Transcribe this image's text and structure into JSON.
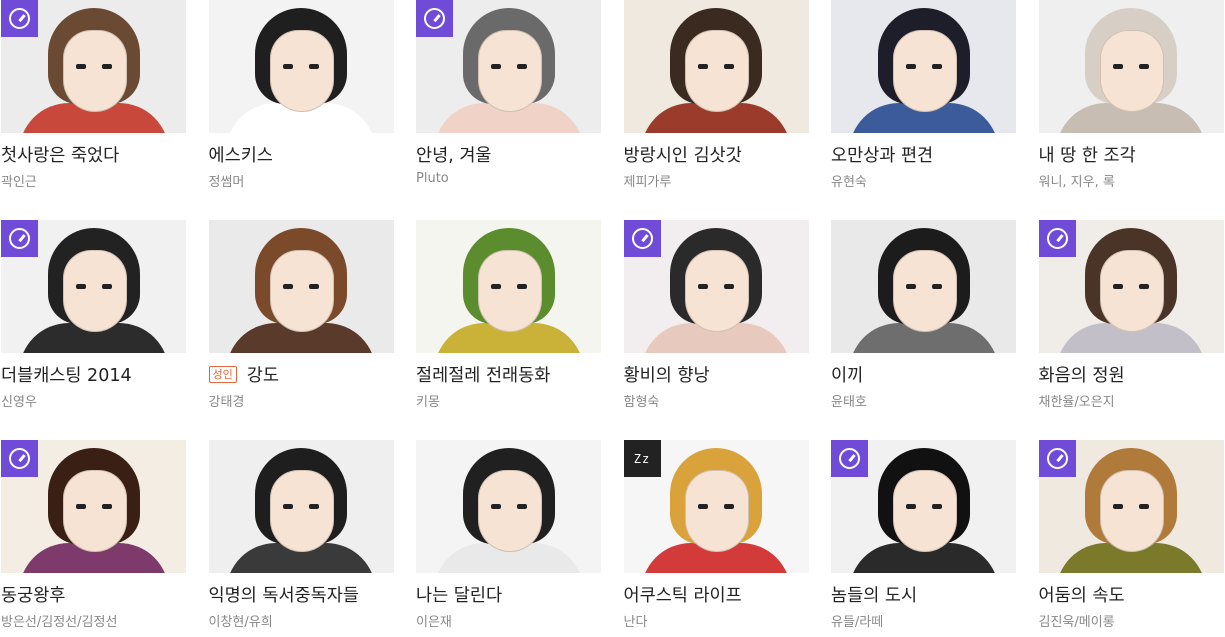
{
  "adult_label": "성인",
  "badge_text": "Zz",
  "items": [
    {
      "title": "첫사랑은 죽었다",
      "author": "곽인근",
      "badge": "clock-icon",
      "bg": "#ececec",
      "hair": "#6b4a34",
      "body": "#c9483c"
    },
    {
      "title": "에스키스",
      "author": "정썸머",
      "badge": "none",
      "bg": "#f3f3f3",
      "hair": "#1f1f1f",
      "body": "#ffffff"
    },
    {
      "title": "안녕, 겨울",
      "author": "Pluto",
      "badge": "clock-icon",
      "bg": "#ededed",
      "hair": "#6a6a6a",
      "body": "#f0d2c6"
    },
    {
      "title": "방랑시인 김삿갓",
      "author": "제피가루",
      "badge": "none",
      "bg": "#efe9df",
      "hair": "#3a2a20",
      "body": "#9a3b2b"
    },
    {
      "title": "오만상과 편견",
      "author": "유현숙",
      "badge": "none",
      "bg": "#e7e8ee",
      "hair": "#1e1e2a",
      "body": "#3c5b9a"
    },
    {
      "title": "내 땅 한 조각",
      "author": "워니, 지우, 록",
      "badge": "none",
      "bg": "#efefef",
      "hair": "#d7cfc6",
      "body": "#c7bdb2"
    },
    {
      "title": "더블캐스팅 2014",
      "author": "신영우",
      "badge": "clock-icon",
      "bg": "#f1f1f1",
      "hair": "#222222",
      "body": "#2c2c2c"
    },
    {
      "title": "강도",
      "author": "강태경",
      "badge": "none",
      "adult": true,
      "bg": "#eaeaea",
      "hair": "#7a4a2a",
      "body": "#5a3a2a"
    },
    {
      "title": "절레절레 전래동화",
      "author": "키몽",
      "badge": "none",
      "bg": "#f5f5f0",
      "hair": "#5b8c2e",
      "body": "#c9b237"
    },
    {
      "title": "황비의 향낭",
      "author": "함형숙",
      "badge": "clock-icon",
      "bg": "#f2eeef",
      "hair": "#2a2a2a",
      "body": "#e8c9bd"
    },
    {
      "title": "이끼",
      "author": "윤태호",
      "badge": "none",
      "bg": "#e9e9e9",
      "hair": "#1c1c1c",
      "body": "#6e6e6e"
    },
    {
      "title": "화음의 정원",
      "author": "채한율/오은지",
      "badge": "clock-icon",
      "bg": "#f0ece8",
      "hair": "#4a3428",
      "body": "#c3bfc9"
    },
    {
      "title": "동궁왕후",
      "author": "방은선/김정선/김정선",
      "badge": "clock-icon",
      "bg": "#f3ede3",
      "hair": "#3a1f14",
      "body": "#7d3a6a"
    },
    {
      "title": "익명의 독서중독자들",
      "author": "이창현/유희",
      "badge": "none",
      "bg": "#efefef",
      "hair": "#1e1e1e",
      "body": "#3a3a3a"
    },
    {
      "title": "나는 달린다",
      "author": "이은재",
      "badge": "none",
      "bg": "#f4f4f4",
      "hair": "#202020",
      "body": "#e9e9e9"
    },
    {
      "title": "어쿠스틱 라이프",
      "author": "난다",
      "badge": "zz",
      "bg": "#f6f6f6",
      "hair": "#d9a23a",
      "body": "#d33a3a"
    },
    {
      "title": "놈들의 도시",
      "author": "유들/라떼",
      "badge": "clock-icon",
      "bg": "#f1f1f1",
      "hair": "#111111",
      "body": "#2a2a2a"
    },
    {
      "title": "어둠의 속도",
      "author": "김진욱/메이롱",
      "badge": "clock-icon",
      "bg": "#efe9df",
      "hair": "#b07a3a",
      "body": "#7a7a2a"
    }
  ]
}
